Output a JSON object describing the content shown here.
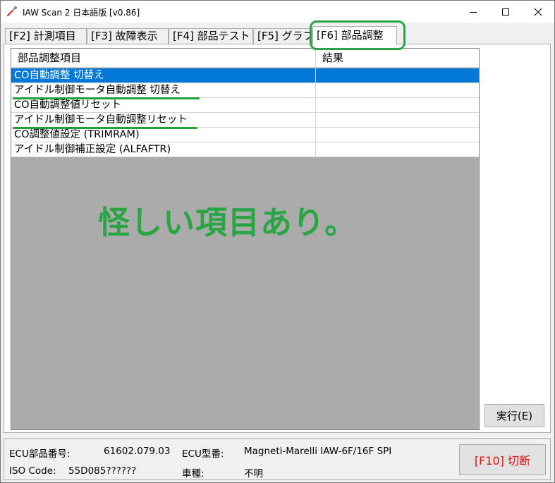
{
  "window": {
    "title": "IAW Scan 2 日本語版 [v0.86]",
    "icon": "wrench-icon"
  },
  "tabs": [
    {
      "label": "[F2] 計測項目"
    },
    {
      "label": "[F3] 故障表示"
    },
    {
      "label": "[F4] 部品テスト"
    },
    {
      "label": "[F5] グラフ"
    },
    {
      "label": "[F6] 部品調整"
    }
  ],
  "active_tab": 4,
  "table": {
    "columns": [
      "部品調整項目",
      "結果"
    ],
    "rows": [
      {
        "item": "CO自動調整 切替え",
        "result": ""
      },
      {
        "item": "アイドル制御モータ自動調整 切替え",
        "result": ""
      },
      {
        "item": "CO自動調整値リセット",
        "result": ""
      },
      {
        "item": "アイドル制御モータ自動調整リセット",
        "result": ""
      },
      {
        "item": "CO調整値設定 (TRIMRAM)",
        "result": ""
      },
      {
        "item": "アイドル制御補正設定 (ALFAFTR)",
        "result": ""
      }
    ],
    "selected_row": 0
  },
  "annotation": {
    "text": "怪しい項目あり。",
    "color": "#2aa543"
  },
  "execute_button": {
    "label": "実行(E)"
  },
  "status": {
    "ecu_part_label": "ECU部品番号:",
    "ecu_part_value": "61602.079.03",
    "ecu_type_label": "ECU型番:",
    "ecu_type_value": "Magneti-Marelli IAW-6F/16F SPI",
    "iso_label": "ISO Code:",
    "iso_value": "55D085??????",
    "vehicle_label": "車種:",
    "vehicle_value": "不明"
  },
  "disconnect_button": {
    "label": "[F10] 切断",
    "color": "#e01010"
  },
  "colors": {
    "selection": "#0078d7",
    "grid_background": "#ababab",
    "annotation_green": "#2aa543"
  }
}
